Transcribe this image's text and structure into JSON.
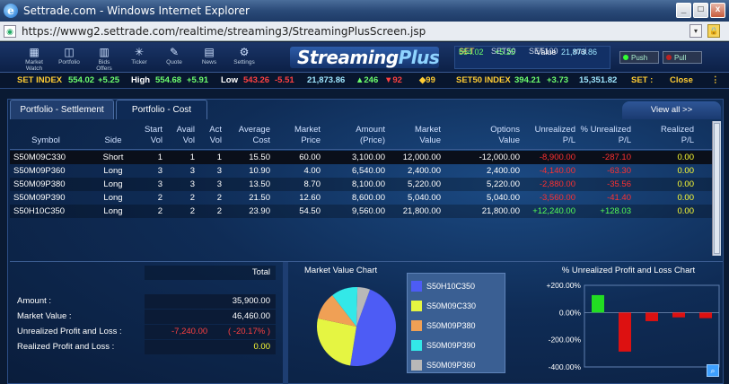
{
  "window": {
    "title": "Settrade.com - Windows Internet Explorer",
    "logo_glyph": "e",
    "btn_min": "_",
    "btn_max": "□",
    "btn_close": "x"
  },
  "address": {
    "url": "https://wwwg2.settrade.com/realtime/streaming3/StreamingPlusScreen.jsp",
    "dropdown": "▾",
    "lock": "🔒"
  },
  "nav": [
    {
      "label": "Market Watch",
      "icon": "grid-icon",
      "glyph": "▦"
    },
    {
      "label": "Portfolio",
      "icon": "portfolio-icon",
      "glyph": "◫"
    },
    {
      "label": "Bids Offers",
      "icon": "bids-offers-icon",
      "glyph": "▥"
    },
    {
      "label": "Ticker",
      "icon": "ticker-icon",
      "glyph": "✳"
    },
    {
      "label": "Quote",
      "icon": "quote-icon",
      "glyph": "✎"
    },
    {
      "label": "News",
      "icon": "news-icon",
      "glyph": "▤"
    },
    {
      "label": "Settings",
      "icon": "settings-icon",
      "glyph": "⚙"
    }
  ],
  "brand": {
    "part1": "Streaming",
    "part2": "Plus"
  },
  "market_box": {
    "h1": "SET",
    "h2": "SET50",
    "h3": "SET100",
    "h4": "mai",
    "v1": "554.02",
    "v2": "+5.25",
    "v3_label": "Value",
    "v3": "21,873.86"
  },
  "pushpull": {
    "push": "Push",
    "pull": "Pull"
  },
  "ticker": {
    "set_label": "SET INDEX",
    "set_val": "554.02",
    "set_chg": "+5.25",
    "high_label": "High",
    "high_val": "554.68",
    "high_chg": "+5.91",
    "low_label": "Low",
    "low_val": "543.26",
    "low_chg": "-5.51",
    "value": "21,873.86",
    "up": "▲246",
    "down": "▼92",
    "same": "◆99",
    "set50_label": "SET50 INDEX",
    "set50_val": "394.21",
    "set50_chg": "+3.73",
    "set50_value": "15,351.82",
    "status_label": "SET :",
    "status": "Close",
    "more": "⋮"
  },
  "datetime": {
    "date": "Mon 25 May 2009",
    "clock": "◷",
    "time": "3:55:21"
  },
  "tabs": {
    "settlement": "Portfolio - Settlement",
    "cost": "Portfolio - Cost",
    "viewall": "View all >>"
  },
  "columns": [
    {
      "key": "symbol",
      "l1": "",
      "l2": "Symbol"
    },
    {
      "key": "side",
      "l1": "",
      "l2": "Side"
    },
    {
      "key": "start_vol",
      "l1": "Start",
      "l2": "Vol"
    },
    {
      "key": "avail_vol",
      "l1": "Avail",
      "l2": "Vol"
    },
    {
      "key": "act_vol",
      "l1": "Act",
      "l2": "Vol"
    },
    {
      "key": "avg_cost",
      "l1": "Average",
      "l2": "Cost"
    },
    {
      "key": "mkt_price",
      "l1": "Market",
      "l2": "Price"
    },
    {
      "key": "amount",
      "l1": "Amount",
      "l2": "(Price)"
    },
    {
      "key": "mkt_value",
      "l1": "Market",
      "l2": "Value"
    },
    {
      "key": "opt_value",
      "l1": "Options",
      "l2": "Value"
    },
    {
      "key": "unreal",
      "l1": "Unrealized",
      "l2": "P/L"
    },
    {
      "key": "pct_unreal",
      "l1": "% Unrealized",
      "l2": "P/L"
    },
    {
      "key": "real",
      "l1": "Realized",
      "l2": "P/L"
    }
  ],
  "rows": [
    {
      "symbol": "S50M09C330",
      "side": "Short",
      "start_vol": "1",
      "avail_vol": "1",
      "act_vol": "1",
      "avg_cost": "15.50",
      "mkt_price": "60.00",
      "amount": "3,100.00",
      "mkt_value": "12,000.00",
      "opt_value": "-12,000.00",
      "unreal": "-8,900.00",
      "pct_unreal": "-287.10",
      "real": "0.00",
      "sign": "neg"
    },
    {
      "symbol": "S50M09P360",
      "side": "Long",
      "start_vol": "3",
      "avail_vol": "3",
      "act_vol": "3",
      "avg_cost": "10.90",
      "mkt_price": "4.00",
      "amount": "6,540.00",
      "mkt_value": "2,400.00",
      "opt_value": "2,400.00",
      "unreal": "-4,140.00",
      "pct_unreal": "-63.30",
      "real": "0.00",
      "sign": "neg"
    },
    {
      "symbol": "S50M09P380",
      "side": "Long",
      "start_vol": "3",
      "avail_vol": "3",
      "act_vol": "3",
      "avg_cost": "13.50",
      "mkt_price": "8.70",
      "amount": "8,100.00",
      "mkt_value": "5,220.00",
      "opt_value": "5,220.00",
      "unreal": "-2,880.00",
      "pct_unreal": "-35.56",
      "real": "0.00",
      "sign": "neg"
    },
    {
      "symbol": "S50M09P390",
      "side": "Long",
      "start_vol": "2",
      "avail_vol": "2",
      "act_vol": "2",
      "avg_cost": "21.50",
      "mkt_price": "12.60",
      "amount": "8,600.00",
      "mkt_value": "5,040.00",
      "opt_value": "5,040.00",
      "unreal": "-3,560.00",
      "pct_unreal": "-41.40",
      "real": "0.00",
      "sign": "neg"
    },
    {
      "symbol": "S50H10C350",
      "side": "Long",
      "start_vol": "2",
      "avail_vol": "2",
      "act_vol": "2",
      "avg_cost": "23.90",
      "mkt_price": "54.50",
      "amount": "9,560.00",
      "mkt_value": "21,800.00",
      "opt_value": "21,800.00",
      "unreal": "+12,240.00",
      "pct_unreal": "+128.03",
      "real": "0.00",
      "sign": "pos"
    }
  ],
  "summary": {
    "total_label": "Total",
    "amount_label": "Amount :",
    "amount": "35,900.00",
    "mv_label": "Market Value :",
    "mv": "46,460.00",
    "upl_label": "Unrealized Profit and Loss :",
    "upl": "-7,240.00",
    "upl_pct": "( -20.17% )",
    "rpl_label": "Realized Profit and Loss :",
    "rpl": "0.00"
  },
  "colors": {
    "pie_s50h10c350": "#4d5cf5",
    "pie_s50m09c330": "#e5f542",
    "pie_s50m09p380": "#f0a055",
    "pie_s50m09p390": "#33e8e8",
    "pie_s50m09p360": "#b8b8b8",
    "bar_pos": "#22dd22",
    "bar_neg": "#dd1111"
  },
  "chart_data": [
    {
      "type": "pie",
      "title": "Market Value Chart",
      "categories": [
        "S50H10C350",
        "S50M09C330",
        "S50M09P380",
        "S50M09P390",
        "S50M09P360"
      ],
      "values": [
        21800,
        12000,
        5220,
        5040,
        2400
      ]
    },
    {
      "type": "bar",
      "title": "% Unrealized Profit and Loss Chart",
      "categories": [
        "S50H10C350",
        "S50M09C330",
        "S50M09P360",
        "S50M09P380",
        "S50M09P390"
      ],
      "values": [
        128.03,
        -287.1,
        -63.3,
        -35.56,
        -41.4
      ],
      "yticks": [
        "+200.00%",
        "0.00%",
        "-200.00%",
        "-400.00%"
      ],
      "ylim": [
        -400,
        200
      ]
    }
  ],
  "magnifier": "⌕"
}
